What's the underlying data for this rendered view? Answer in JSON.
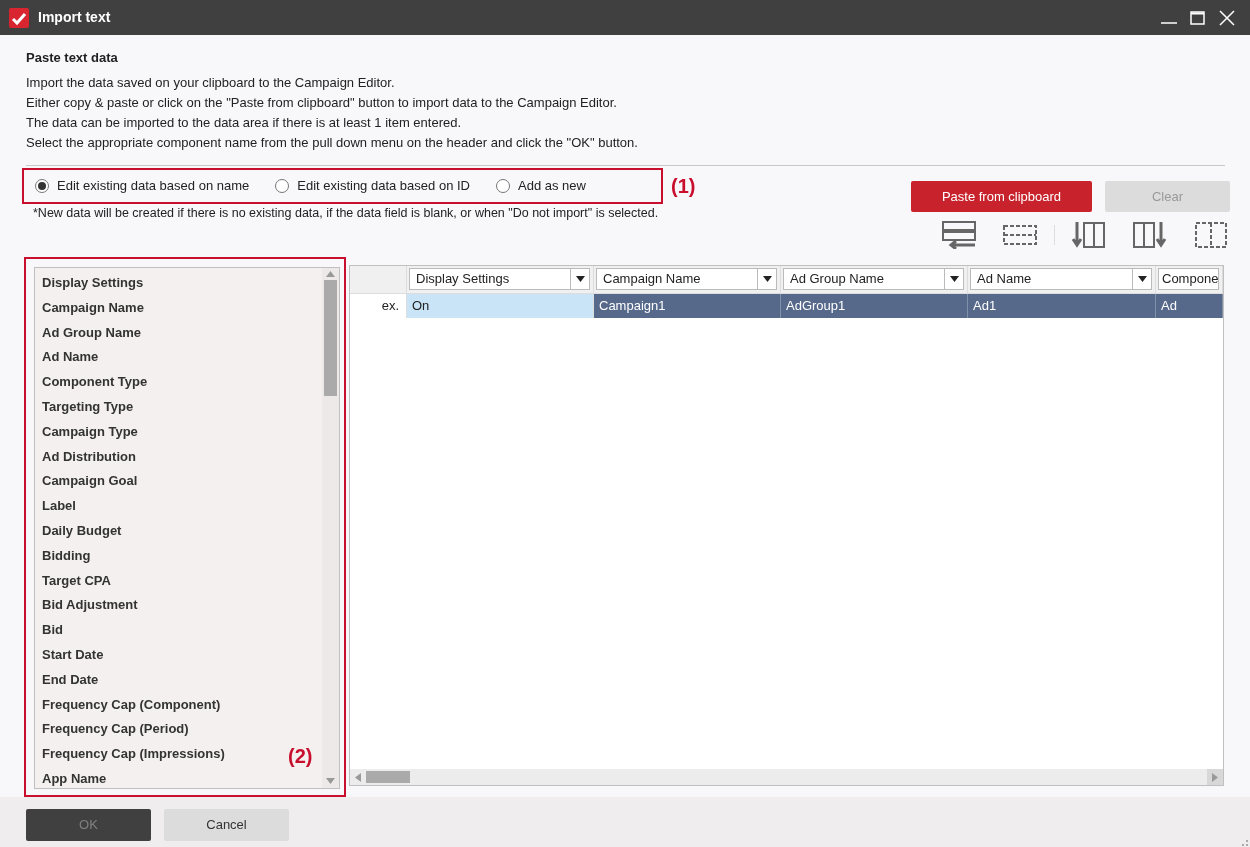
{
  "window": {
    "title": "Import text"
  },
  "heading": "Paste text data",
  "description": [
    "Import the data saved on your clipboard to the Campaign Editor.",
    "Either copy & paste or click on the \"Paste from clipboard\" button to import data to the Campaign Editor.",
    "The data can be imported to the data area if there is at least 1 item entered.",
    "Select the appropriate component name from the pull down menu on the header and click the \"OK\" button."
  ],
  "import_modes": [
    {
      "label": "Edit existing data based on name",
      "selected": true
    },
    {
      "label": "Edit existing data based on ID",
      "selected": false
    },
    {
      "label": "Add as new",
      "selected": false
    }
  ],
  "annotation_1": "(1)",
  "note": "*New data will be created if there is no existing data, if the data field is blank, or when \"Do not import\" is selected.",
  "buttons": [
    {
      "label": "Paste from clipboard",
      "kind": "primary",
      "disabled": false
    },
    {
      "label": "Clear",
      "kind": "secondary",
      "disabled": true
    }
  ],
  "fields": [
    "Display Settings",
    "Campaign Name",
    "Ad Group Name",
    "Ad Name",
    "Component Type",
    "Targeting Type",
    "Campaign Type",
    "Ad Distribution",
    "Campaign Goal",
    "Label",
    "Daily Budget",
    "Bidding",
    "Target CPA",
    "Bid Adjustment",
    "Bid",
    "Start Date",
    "End Date",
    "Frequency Cap (Component)",
    "Frequency Cap (Period)",
    "Frequency Cap (Impressions)",
    "App Name"
  ],
  "annotation_2": "(2)",
  "grid": {
    "columns": [
      {
        "header": "Display Settings"
      },
      {
        "header": "Campaign Name"
      },
      {
        "header": "Ad Group Name"
      },
      {
        "header": "Ad Name"
      },
      {
        "header": "Compone"
      }
    ],
    "row_label": "ex.",
    "cells": [
      {
        "value": "On",
        "kind": "focused"
      },
      {
        "value": "Campaign1",
        "kind": "selected"
      },
      {
        "value": "AdGroup1",
        "kind": "selected"
      },
      {
        "value": "Ad1",
        "kind": "selected"
      },
      {
        "value": "Ad",
        "kind": "selected"
      }
    ]
  },
  "footer": [
    {
      "label": "OK",
      "kind": "primary",
      "disabled": true
    },
    {
      "label": "Cancel",
      "kind": "secondary",
      "disabled": false
    }
  ]
}
